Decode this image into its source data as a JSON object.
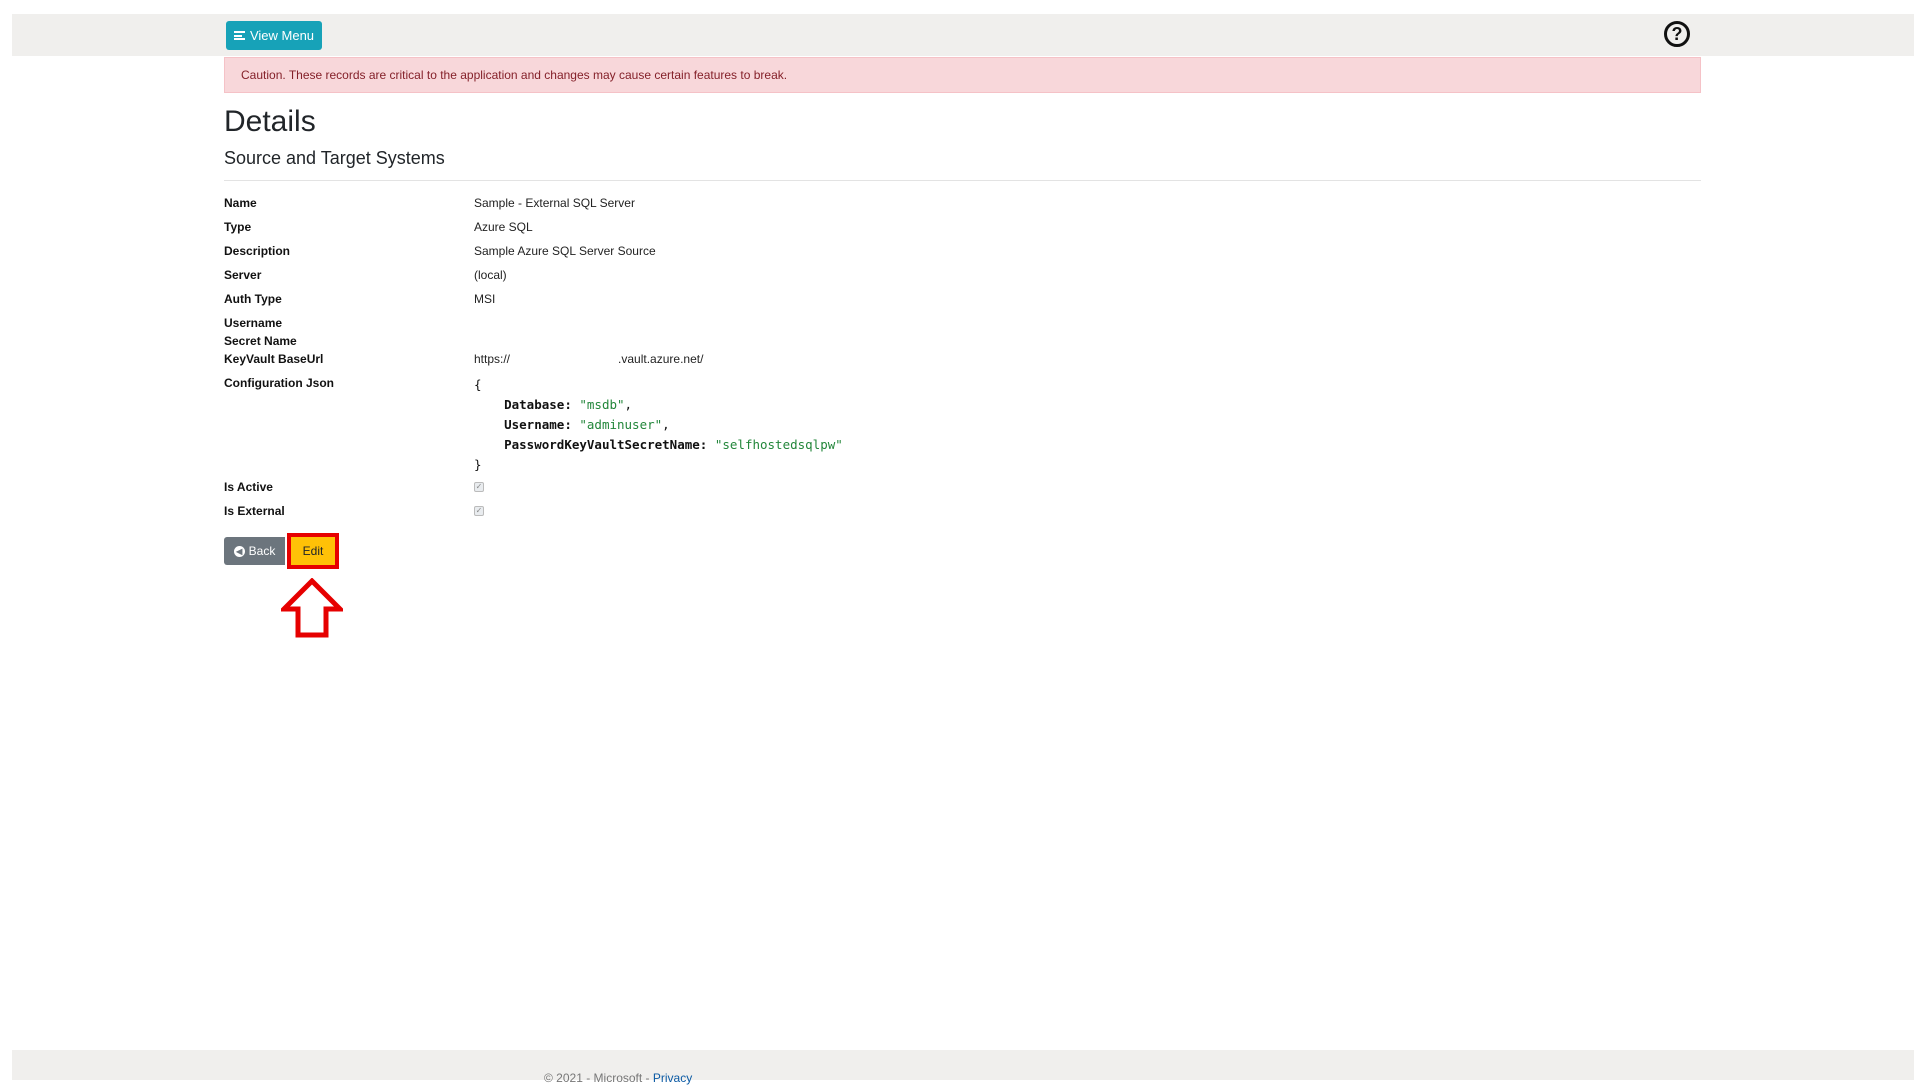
{
  "header": {
    "view_menu_label": "View Menu",
    "help_icon": "question-circle-icon",
    "help_glyph": "?"
  },
  "alert": {
    "text": "Caution. These records are critical to the application and changes may cause certain features to break."
  },
  "page": {
    "title": "Details",
    "subtitle": "Source and Target Systems"
  },
  "fields": [
    {
      "label": "Name",
      "value": "Sample - External SQL Server"
    },
    {
      "label": "Type",
      "value": "Azure SQL"
    },
    {
      "label": "Description",
      "value": "Sample Azure SQL Server Source"
    },
    {
      "label": "Server",
      "value": "(local)"
    },
    {
      "label": "Auth Type",
      "value": "MSI"
    },
    {
      "label": "Username",
      "value": ""
    },
    {
      "label": "Secret Name",
      "value": ""
    },
    {
      "label": "KeyVault BaseUrl",
      "value_prefix": "https://",
      "value_suffix": ".vault.azure.net/"
    }
  ],
  "config_json": {
    "label": "Configuration Json",
    "open": "{",
    "close": "}",
    "entries": [
      {
        "key": "Database:",
        "value": "\"msdb\"",
        "sep": ","
      },
      {
        "key": "Username:",
        "value": "\"adminuser\"",
        "sep": ","
      },
      {
        "key": "PasswordKeyVaultSecretName:",
        "value": "\"selfhostedsqlpw\"",
        "sep": ""
      }
    ]
  },
  "flags": [
    {
      "label": "Is Active",
      "checked": true
    },
    {
      "label": "Is External",
      "checked": true
    }
  ],
  "actions": {
    "back_label": "Back",
    "edit_label": "Edit",
    "back_icon": "arrow-left-circle-icon",
    "highlight_color": "#e60000"
  },
  "footer": {
    "copyright": "© 2021 - Microsoft - ",
    "privacy_label": "Privacy"
  },
  "colors": {
    "view_menu": "#17a2b8",
    "alert_bg": "#f8d7da",
    "alert_text": "#842029",
    "edit_bg": "#ffc107",
    "back_bg": "#6c757d"
  }
}
